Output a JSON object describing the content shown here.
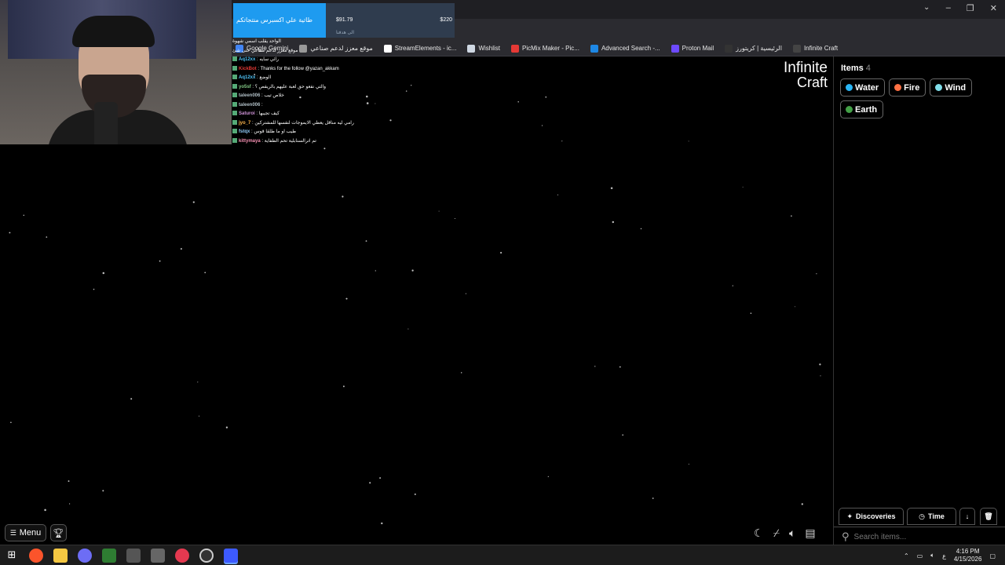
{
  "browser": {
    "bookmarks": [
      {
        "label": "Google Gemini",
        "color": "#4285f4"
      },
      {
        "label": "موقع معزز لدعم صناعي",
        "color": "#999999"
      },
      {
        "label": "StreamElements - ic...",
        "color": "#ffffff"
      },
      {
        "label": "Wishlist",
        "color": "#cfd8e3"
      },
      {
        "label": "PicMix Maker - Pic...",
        "color": "#e53935"
      },
      {
        "label": "Advanced Search -...",
        "color": "#1e88e5"
      },
      {
        "label": "Proton Mail",
        "color": "#6d4aff"
      },
      {
        "label": "الرئيسية | كريتورز",
        "color": "#333333"
      },
      {
        "label": "Infinite Craft",
        "color": "#444444"
      }
    ]
  },
  "goal": {
    "title": "طاتية علي اكسبرس منتجاتكم",
    "current": "$91.79",
    "target": "$220",
    "progress": 0.42,
    "sub": "الى هدفنا"
  },
  "chat": [
    {
      "user": "",
      "text": "الواحد يقلب اسمي شهوة",
      "color": "#ffffff"
    },
    {
      "user": "",
      "text": "موقع معزز لدعم صناعي حتى شئ",
      "color": "#ffffff"
    },
    {
      "user": "Aq12xx",
      "text": "رائي سايه",
      "color": "#4fc3f7"
    },
    {
      "user": "KickBot",
      "text": "Thanks for the follow @yazan_akkam",
      "color": "#e53935"
    },
    {
      "user": "Aq12xx",
      "text": "الوضع",
      "color": "#4fc3f7"
    },
    {
      "user": "yo5sf",
      "text": "والتي نفعو حق لعبة عليهم بالريفص ؟",
      "color": "#81c784"
    },
    {
      "user": "taleen006",
      "text": "خلاص تيب",
      "color": "#b0bec5"
    },
    {
      "user": "taleen006",
      "text": "",
      "color": "#b0bec5"
    },
    {
      "user": "Saturoi",
      "text": "كيف تجيبها",
      "color": "#ce93d8"
    },
    {
      "user": "jyo_7",
      "text": "رامي ليه مناقل يعطي الايموجات لنفسها للمشتركين",
      "color": "#ffb74d"
    },
    {
      "user": "fstqx",
      "text": "طيب او ما طلقا قوس",
      "color": "#90caf9"
    },
    {
      "user": "kittymaya",
      "text": "تم اترالسنابلية تحم الطفاية",
      "color": "#f48fb1"
    }
  ],
  "logo": {
    "line1": "Infinite",
    "line2": "Craft"
  },
  "menu": {
    "label": "Menu"
  },
  "sidebar": {
    "title": "Items",
    "count": "4",
    "items": [
      {
        "label": "Water",
        "color": "#29b6f6"
      },
      {
        "label": "Fire",
        "color": "#ff7043"
      },
      {
        "label": "Wind",
        "color": "#80deea"
      },
      {
        "label": "Earth",
        "color": "#43a047"
      }
    ],
    "sort": {
      "discoveries": "Discoveries",
      "time": "Time"
    },
    "search_placeholder": "Search items..."
  },
  "taskbar": {
    "time": "4:16 PM",
    "date": "4/15/2026",
    "lang": "ع"
  }
}
